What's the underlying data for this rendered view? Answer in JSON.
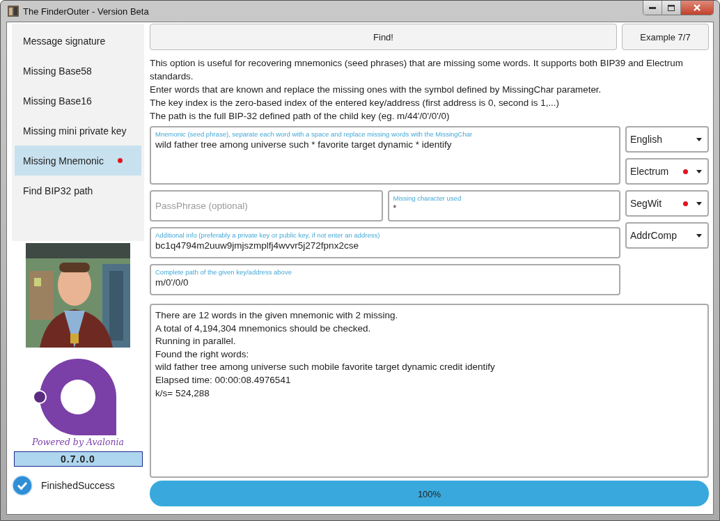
{
  "window": {
    "title": "The FinderOuter - Version Beta"
  },
  "sidebar": {
    "items": [
      {
        "label": "Message signature",
        "selected": false,
        "dot": false
      },
      {
        "label": "Missing Base58",
        "selected": false,
        "dot": false
      },
      {
        "label": "Missing Base16",
        "selected": false,
        "dot": false
      },
      {
        "label": "Missing mini private key",
        "selected": false,
        "dot": false
      },
      {
        "label": "Missing Mnemonic",
        "selected": true,
        "dot": true
      },
      {
        "label": "Find BIP32 path",
        "selected": false,
        "dot": false
      }
    ]
  },
  "logo": {
    "caption": "Powered by Avalonia"
  },
  "version": "0.7.0.0",
  "status": {
    "text": "FinishedSuccess"
  },
  "buttons": {
    "find": "Find!",
    "example": "Example 7/7"
  },
  "description": [
    "This option is useful for recovering mnemonics (seed phrases) that are missing some words. It supports both BIP39 and Electrum standards.",
    "Enter words that are known and replace the missing ones with the symbol defined by MissingChar parameter.",
    "The key index is the zero-based index of the entered key/address (first address is 0, second is 1,...)",
    "The path is the full BIP-32 defined path of the child key (eg. m/44'/0'/0'/0)"
  ],
  "mnemonic": {
    "label": "Mnemonic (seed phrase), separate each word with a space and replace missing words with the MissingChar",
    "value": "wild father tree among universe such * favorite target dynamic * identify"
  },
  "passphrase": {
    "placeholder": "PassPhrase (optional)"
  },
  "missing_char": {
    "label": "Missing character used",
    "value": "*"
  },
  "additional_info": {
    "label": "Additional info (preferably a private key or public key, if not enter an address)",
    "value": "bc1q4794m2uuw9jmjszmplfj4wvvr5j272fpnx2cse"
  },
  "path": {
    "label": "Complete path of the given key/address above",
    "value": "m/0'/0/0"
  },
  "dropdowns": [
    {
      "value": "English",
      "dot": false
    },
    {
      "value": "Electrum",
      "dot": true
    },
    {
      "value": "SegWit",
      "dot": true
    },
    {
      "value": "AddrComp",
      "dot": false
    }
  ],
  "output": [
    "There are 12 words in the given mnemonic with 2 missing.",
    "A total of 4,194,304 mnemonics should be checked.",
    "Running in parallel.",
    "Found the right words:",
    "wild father tree among universe such mobile favorite target dynamic credit identify",
    "Elapsed time: 00:00:08.4976541",
    "k/s= 524,288"
  ],
  "progress": {
    "level": 1,
    "label": "100%"
  }
}
